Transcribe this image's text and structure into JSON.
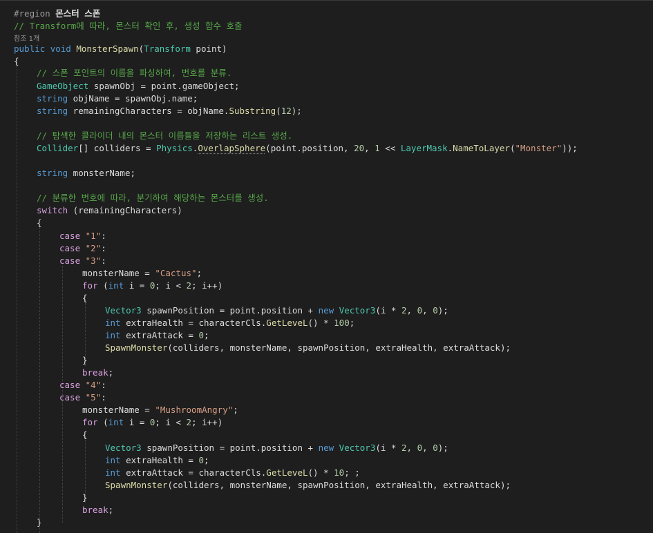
{
  "editor": {
    "language": "C#",
    "colors": {
      "background": "#1e1e1e",
      "keyword": "#569cd6",
      "control_keyword": "#d8a0df",
      "type": "#4ec9b0",
      "string": "#d69d85",
      "number": "#b5cea8",
      "comment": "#57a64a",
      "method": "#dcdcaa",
      "plain": "#dcdcdc"
    },
    "lines": [
      [
        {
          "t": "#region ",
          "c": "pp"
        },
        {
          "t": "몬스터 스폰",
          "c": "rg"
        }
      ],
      [
        {
          "t": "// Transform에 따라, 몬스터 확인 후, 생성 함수 호출",
          "c": "c"
        }
      ],
      [
        {
          "t": "참조 1개",
          "c": "codelens"
        }
      ],
      [
        {
          "t": "public",
          "c": "k"
        },
        {
          "t": " "
        },
        {
          "t": "void",
          "c": "k"
        },
        {
          "t": " "
        },
        {
          "t": "MonsterSpawn",
          "c": "m"
        },
        {
          "t": "("
        },
        {
          "t": "Transform",
          "c": "t"
        },
        {
          "t": " point)"
        }
      ],
      [
        {
          "t": "{"
        }
      ],
      [
        {
          "t": "// 스폰 포인트의 이름을 파싱하여, 번호를 분류.",
          "c": "c"
        }
      ],
      [
        {
          "t": "GameObject",
          "c": "t"
        },
        {
          "t": " spawnObj = point.gameObject;"
        }
      ],
      [
        {
          "t": "string",
          "c": "k"
        },
        {
          "t": " objName = spawnObj.name;"
        }
      ],
      [
        {
          "t": "string",
          "c": "k"
        },
        {
          "t": " remainingCharacters = objName."
        },
        {
          "t": "Substring",
          "c": "m"
        },
        {
          "t": "("
        },
        {
          "t": "12",
          "c": "n"
        },
        {
          "t": ");"
        }
      ],
      [],
      [
        {
          "t": "// 탐색한 콜라이더 내의 몬스터 이름들을 저장하는 리스트 생성.",
          "c": "c"
        }
      ],
      [
        {
          "t": "Collider",
          "c": "t"
        },
        {
          "t": "[] colliders = "
        },
        {
          "t": "Physics",
          "c": "t"
        },
        {
          "t": "."
        },
        {
          "t": "OverlapSphere",
          "c": "m squig"
        },
        {
          "t": "(point.position, "
        },
        {
          "t": "20",
          "c": "n"
        },
        {
          "t": ", "
        },
        {
          "t": "1",
          "c": "n"
        },
        {
          "t": " << "
        },
        {
          "t": "LayerMask",
          "c": "t"
        },
        {
          "t": "."
        },
        {
          "t": "NameToLayer",
          "c": "m"
        },
        {
          "t": "("
        },
        {
          "t": "\"Monster\"",
          "c": "s"
        },
        {
          "t": "));"
        }
      ],
      [],
      [
        {
          "t": "string",
          "c": "k"
        },
        {
          "t": " monsterName;"
        }
      ],
      [],
      [
        {
          "t": "// 분류한 번호에 따라, 분기하여 해당하는 몬스터를 생성.",
          "c": "c"
        }
      ],
      [
        {
          "t": "switch",
          "c": "ctl"
        },
        {
          "t": " (remainingCharacters)"
        }
      ],
      [
        {
          "t": "{"
        }
      ],
      [
        {
          "t": "case",
          "c": "ctl"
        },
        {
          "t": " "
        },
        {
          "t": "\"1\"",
          "c": "s"
        },
        {
          "t": ":"
        }
      ],
      [
        {
          "t": "case",
          "c": "ctl"
        },
        {
          "t": " "
        },
        {
          "t": "\"2\"",
          "c": "s"
        },
        {
          "t": ":"
        }
      ],
      [
        {
          "t": "case",
          "c": "ctl"
        },
        {
          "t": " "
        },
        {
          "t": "\"3\"",
          "c": "s"
        },
        {
          "t": ":"
        }
      ],
      [
        {
          "t": "monsterName = "
        },
        {
          "t": "\"Cactus\"",
          "c": "s"
        },
        {
          "t": ";"
        }
      ],
      [
        {
          "t": "for",
          "c": "ctl"
        },
        {
          "t": " ("
        },
        {
          "t": "int",
          "c": "k"
        },
        {
          "t": " i = "
        },
        {
          "t": "0",
          "c": "n"
        },
        {
          "t": "; i < "
        },
        {
          "t": "2",
          "c": "n"
        },
        {
          "t": "; i++)"
        }
      ],
      [
        {
          "t": "{"
        }
      ],
      [
        {
          "t": "Vector3",
          "c": "t"
        },
        {
          "t": " spawnPosition = point.position + "
        },
        {
          "t": "new",
          "c": "k"
        },
        {
          "t": " "
        },
        {
          "t": "Vector3",
          "c": "t"
        },
        {
          "t": "(i * "
        },
        {
          "t": "2",
          "c": "n"
        },
        {
          "t": ", "
        },
        {
          "t": "0",
          "c": "n"
        },
        {
          "t": ", "
        },
        {
          "t": "0",
          "c": "n"
        },
        {
          "t": ");"
        }
      ],
      [
        {
          "t": "int",
          "c": "k"
        },
        {
          "t": " extraHealth = characterCls."
        },
        {
          "t": "GetLeveL",
          "c": "m"
        },
        {
          "t": "() * "
        },
        {
          "t": "100",
          "c": "n"
        },
        {
          "t": ";"
        }
      ],
      [
        {
          "t": "int",
          "c": "k"
        },
        {
          "t": " extraAttack = "
        },
        {
          "t": "0",
          "c": "n"
        },
        {
          "t": ";"
        }
      ],
      [
        {
          "t": "SpawnMonster",
          "c": "m"
        },
        {
          "t": "(colliders, monsterName, spawnPosition, extraHealth, extraAttack);"
        }
      ],
      [
        {
          "t": "}"
        }
      ],
      [
        {
          "t": "break",
          "c": "ctl"
        },
        {
          "t": ";"
        }
      ],
      [
        {
          "t": "case",
          "c": "ctl"
        },
        {
          "t": " "
        },
        {
          "t": "\"4\"",
          "c": "s"
        },
        {
          "t": ":"
        }
      ],
      [
        {
          "t": "case",
          "c": "ctl"
        },
        {
          "t": " "
        },
        {
          "t": "\"5\"",
          "c": "s"
        },
        {
          "t": ":"
        }
      ],
      [
        {
          "t": "monsterName = "
        },
        {
          "t": "\"MushroomAngry\"",
          "c": "s"
        },
        {
          "t": ";"
        }
      ],
      [
        {
          "t": "for",
          "c": "ctl"
        },
        {
          "t": " ("
        },
        {
          "t": "int",
          "c": "k"
        },
        {
          "t": " i = "
        },
        {
          "t": "0",
          "c": "n"
        },
        {
          "t": "; i < "
        },
        {
          "t": "2",
          "c": "n"
        },
        {
          "t": "; i++)"
        }
      ],
      [
        {
          "t": "{"
        }
      ],
      [
        {
          "t": "Vector3",
          "c": "t"
        },
        {
          "t": " spawnPosition = point.position + "
        },
        {
          "t": "new",
          "c": "k"
        },
        {
          "t": " "
        },
        {
          "t": "Vector3",
          "c": "t"
        },
        {
          "t": "(i * "
        },
        {
          "t": "2",
          "c": "n"
        },
        {
          "t": ", "
        },
        {
          "t": "0",
          "c": "n"
        },
        {
          "t": ", "
        },
        {
          "t": "0",
          "c": "n"
        },
        {
          "t": ");"
        }
      ],
      [
        {
          "t": "int",
          "c": "k"
        },
        {
          "t": " extraHealth = "
        },
        {
          "t": "0",
          "c": "n"
        },
        {
          "t": ";"
        }
      ],
      [
        {
          "t": "int",
          "c": "k"
        },
        {
          "t": " extraAttack = characterCls."
        },
        {
          "t": "GetLeveL",
          "c": "m"
        },
        {
          "t": "() * "
        },
        {
          "t": "10",
          "c": "n"
        },
        {
          "t": "; ;"
        }
      ],
      [
        {
          "t": "SpawnMonster",
          "c": "m"
        },
        {
          "t": "(colliders, monsterName, spawnPosition, extraHealth, extraAttack);"
        }
      ],
      [
        {
          "t": "}"
        }
      ],
      [
        {
          "t": "break",
          "c": "ctl"
        },
        {
          "t": ";"
        }
      ],
      [
        {
          "t": "}"
        }
      ]
    ]
  }
}
